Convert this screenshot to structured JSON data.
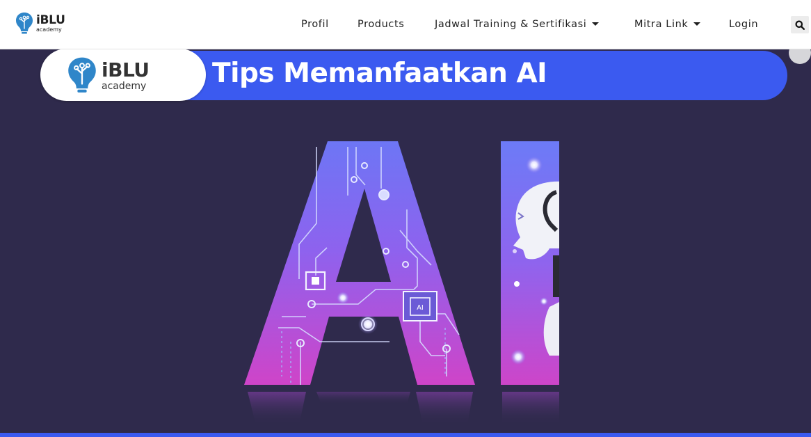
{
  "header": {
    "logo_main": "iBLU",
    "logo_sub": "academy",
    "nav": [
      {
        "label": "Profil",
        "dropdown": false
      },
      {
        "label": "Products",
        "dropdown": false
      },
      {
        "label": "Jadwal Training & Sertifikasi",
        "dropdown": true
      },
      {
        "label": "Mitra Link",
        "dropdown": true
      },
      {
        "label": "Login",
        "dropdown": false
      }
    ],
    "search_icon": "search-icon"
  },
  "hero": {
    "banner_logo_main": "iBLU",
    "banner_logo_sub": "academy",
    "banner_title": "Tips Memanfaatkan AI",
    "chip_text": "AI"
  },
  "colors": {
    "brand_blue": "#3b5af0",
    "hero_bg": "#2f2a4c",
    "logo_blue": "#2f86c9"
  }
}
